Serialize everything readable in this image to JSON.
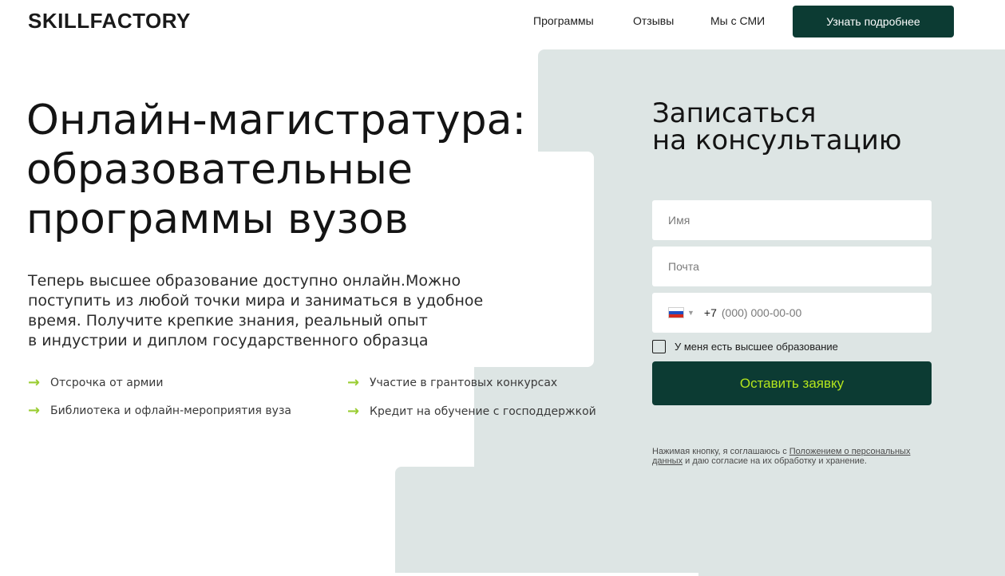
{
  "header": {
    "logo": "SKILLFACTORY",
    "nav": [
      "Программы",
      "Отзывы",
      "Мы с СМИ"
    ],
    "cta": "Узнать подробнее"
  },
  "hero": {
    "title_lines": [
      "Онлайн-магистратура:",
      "образовательные",
      "программы вузов"
    ],
    "subtitle_lines": [
      "Теперь высшее образование доступно онлайн.Можно",
      "поступить из любой точки мира и заниматься в удобное",
      "время. Получите крепкие знания, реальный опыт",
      "в индустрии и диплом государственного образца"
    ],
    "features": [
      "Отсрочка от армии",
      "Участие в грантовых конкурсах",
      "Библиотека и офлайн-мероприятия вуза",
      "Кредит на обучение с господдержкой"
    ],
    "feature_icon": "arrow-right-icon"
  },
  "form": {
    "title_lines": [
      "Записаться",
      "на консультацию"
    ],
    "name_placeholder": "Имя",
    "email_placeholder": "Почта",
    "phone_code": "+7",
    "phone_placeholder": "(000) 000-00-00",
    "flag_icon": "russia-flag-icon",
    "checkbox_label": "У меня есть высшее образование",
    "submit": "Оставить заявку",
    "consent_prefix": "Нажимая кнопку, я соглашаюсь с ",
    "consent_link": "Положением о персональных данных",
    "consent_suffix": " и даю согласие на их обработку и хранение."
  },
  "colors": {
    "accent_dark": "#0c3b33",
    "accent_lime": "#b5e61d",
    "panel_bg": "#dde5e4",
    "arrow": "#9acd32"
  }
}
